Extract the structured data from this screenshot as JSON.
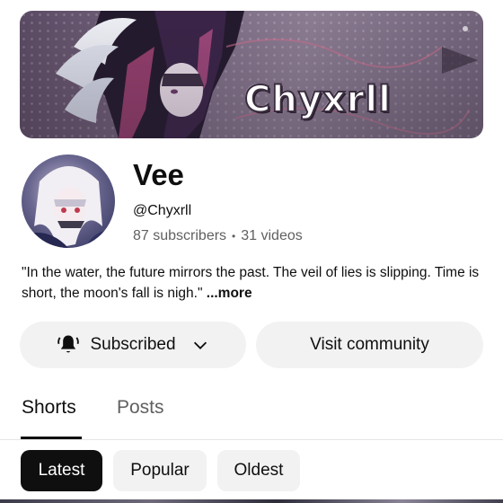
{
  "banner": {
    "text": "Chyxrll",
    "image_desc": "anime-art-banner"
  },
  "channel": {
    "name": "Vee",
    "handle": "@Chyxrll",
    "subscribers": "87 subscribers",
    "separator": "•",
    "videos": "31 videos",
    "description": "\"In the water, the future mirrors the past. The veil of lies is slipping. Time is short, the moon's fall is nigh.\"",
    "more_label": "...more"
  },
  "actions": {
    "subscribe_label": "Subscribed",
    "community_label": "Visit community"
  },
  "tabs": [
    {
      "label": "Shorts",
      "active": true
    },
    {
      "label": "Posts",
      "active": false
    }
  ],
  "filters": [
    {
      "label": "Latest",
      "selected": true
    },
    {
      "label": "Popular",
      "selected": false
    },
    {
      "label": "Oldest",
      "selected": false
    }
  ],
  "colors": {
    "text": "#0f0f0f",
    "secondary": "#606060",
    "chip_bg": "#f2f2f2",
    "chip_selected_bg": "#0f0f0f"
  },
  "icons": {
    "bell": "bell-ring-icon",
    "chevron": "chevron-down-icon"
  }
}
